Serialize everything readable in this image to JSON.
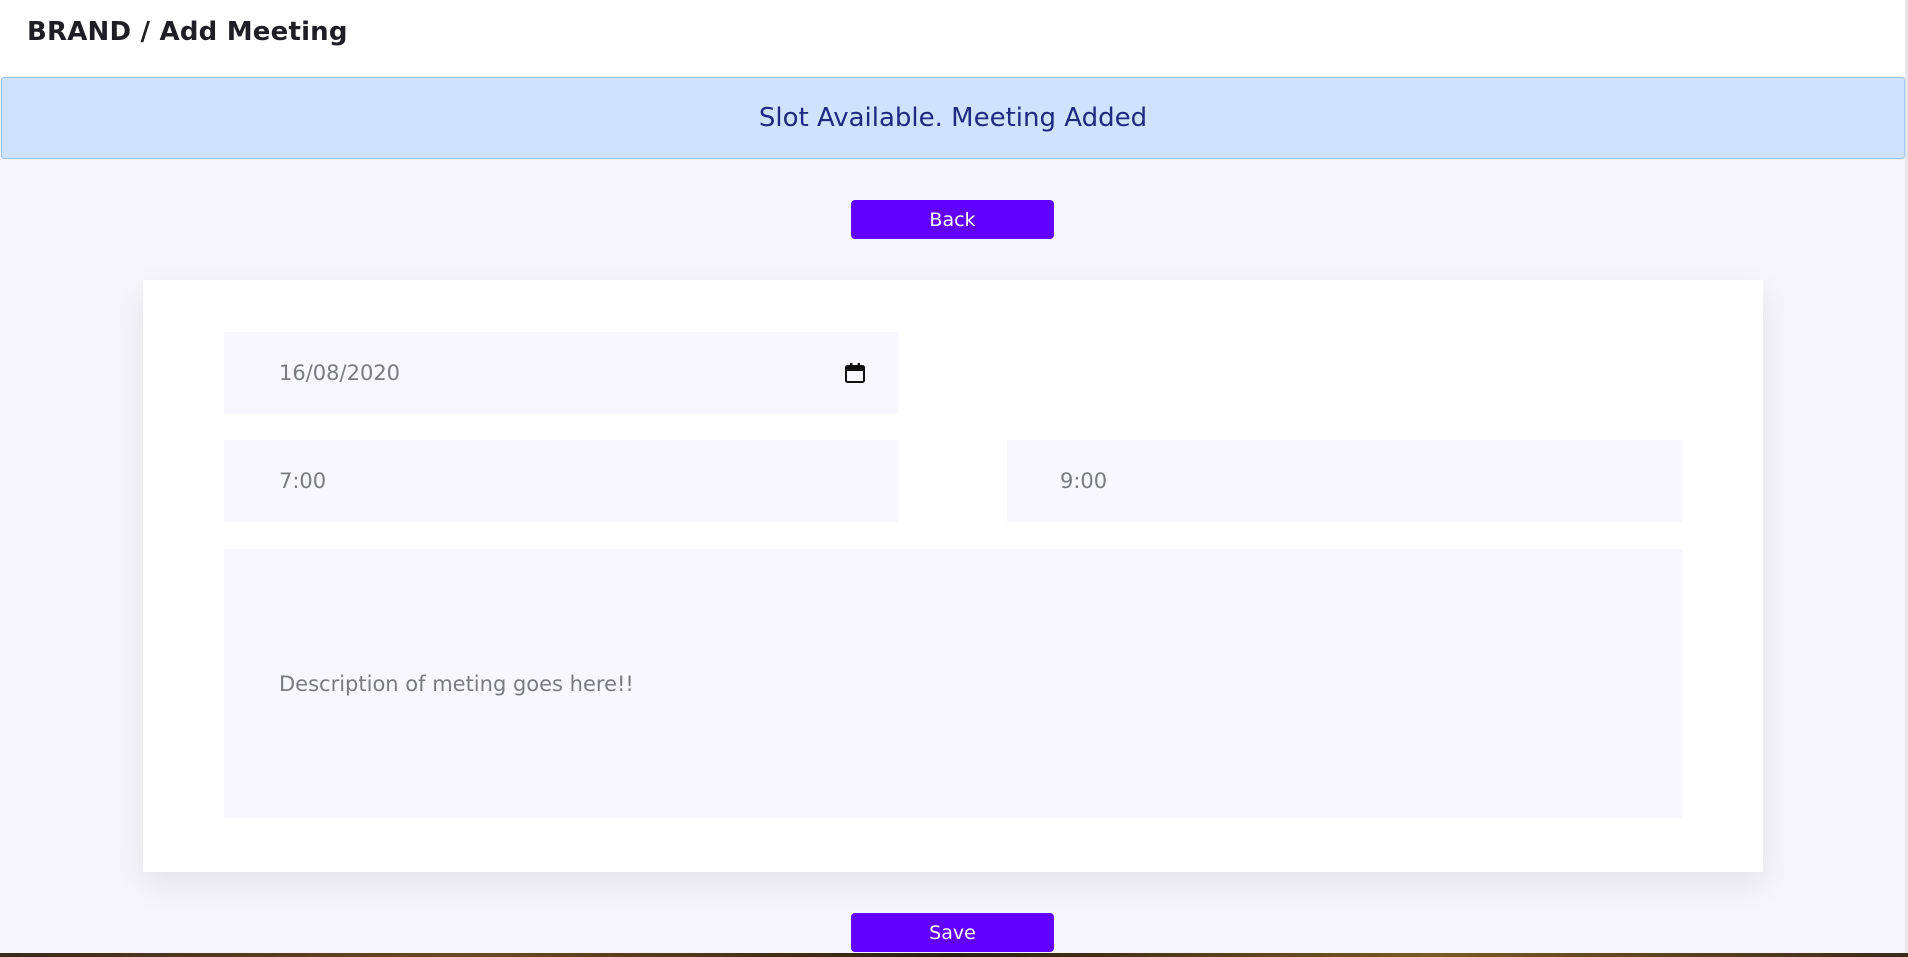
{
  "header": {
    "breadcrumb": "BRAND / Add Meeting"
  },
  "alert": {
    "message": "Slot Available. Meeting Added",
    "color": "#cfe2fe"
  },
  "actions": {
    "back_label": "Back",
    "save_label": "Save",
    "accent": "#6100ff"
  },
  "form": {
    "date_value": "16/08/2020",
    "start_time": "7:00",
    "end_time": "9:00",
    "description": "Description of meting goes here!!"
  },
  "icons": {
    "date_picker": "calendar-icon"
  }
}
